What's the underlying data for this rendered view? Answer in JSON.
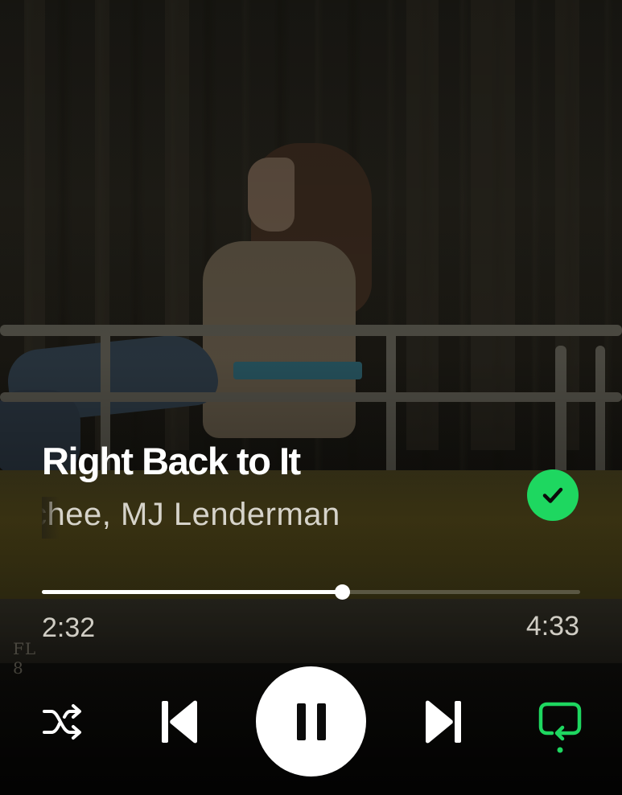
{
  "track": {
    "title": "Right Back to It",
    "artist": "Waxahatchee, MJ Lenderman",
    "artist_visible": "chee, MJ Lenderman",
    "saved": true
  },
  "playback": {
    "elapsed": "2:32",
    "total": "4:33",
    "progress_fraction": 0.557,
    "state": "playing"
  },
  "controls": {
    "shuffle_icon": "shuffle-icon",
    "previous_icon": "skip-previous-icon",
    "play_pause_icon": "pause-icon",
    "next_icon": "skip-next-icon",
    "repeat_icon": "smart-shuffle-repeat-icon",
    "repeat_active": true
  },
  "colors": {
    "accent": "#1ed760",
    "text_primary": "#ffffff",
    "text_secondary": "#d6d3ca"
  }
}
